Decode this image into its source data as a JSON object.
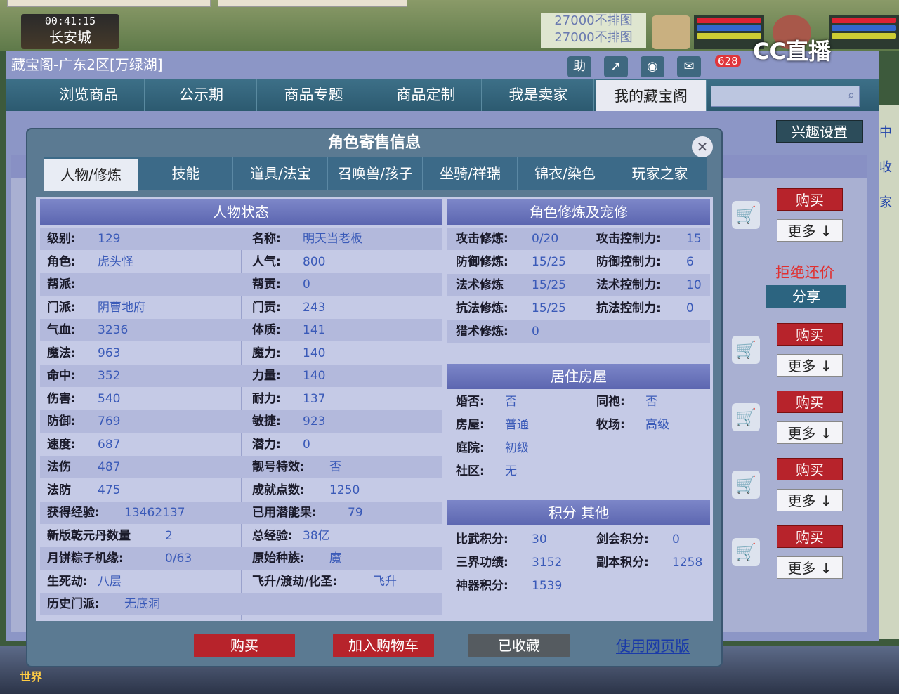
{
  "game": {
    "clock": "00:41:15",
    "city": "长安城",
    "notice_lines": [
      "27000不排图",
      "27000不排图"
    ],
    "cc_logo": "CC直播",
    "world_button": "世界"
  },
  "shop": {
    "title": "藏宝阁-广东2区[万绿湖]",
    "help_label": "助",
    "message_count": "628",
    "nav": [
      "浏览商品",
      "公示期",
      "商品专题",
      "商品定制",
      "我是卖家",
      "我的藏宝阁"
    ],
    "interest_button": "兴趣设置",
    "buy_label": "购买",
    "more_label": "更多",
    "refuse_label": "拒绝还价",
    "share_label": "分享"
  },
  "dialog": {
    "title": "角色寄售信息",
    "tabs": [
      "人物/修炼",
      "技能",
      "道具/法宝",
      "召唤兽/孩子",
      "坐骑/祥瑞",
      "锦衣/染色",
      "玩家之家"
    ],
    "status_header": "人物状态",
    "status_col1": [
      {
        "k": "级别:",
        "v": "129"
      },
      {
        "k": "角色:",
        "v": "虎头怪"
      },
      {
        "k": "帮派:",
        "v": ""
      },
      {
        "k": "门派:",
        "v": "阴曹地府"
      },
      {
        "k": "气血:",
        "v": "3236"
      },
      {
        "k": "魔法:",
        "v": "963"
      },
      {
        "k": "命中:",
        "v": "352"
      },
      {
        "k": "伤害:",
        "v": "540"
      },
      {
        "k": "防御:",
        "v": "769"
      },
      {
        "k": "速度:",
        "v": "687"
      },
      {
        "k": "法伤",
        "v": "487"
      },
      {
        "k": "法防",
        "v": "475"
      },
      {
        "k": "获得经验:",
        "v": "13462137"
      },
      {
        "k": "新版乾元丹数量",
        "v": "2"
      },
      {
        "k": "月饼粽子机缘:",
        "v": "0/63"
      },
      {
        "k": "生死劫:",
        "v": "八层"
      },
      {
        "k": "历史门派:",
        "v": "无底洞"
      }
    ],
    "status_col2": [
      {
        "k": "名称:",
        "v": "明天当老板"
      },
      {
        "k": "人气:",
        "v": "800"
      },
      {
        "k": "帮贡:",
        "v": "0"
      },
      {
        "k": "门贡:",
        "v": "243"
      },
      {
        "k": "体质:",
        "v": "141"
      },
      {
        "k": "魔力:",
        "v": "140"
      },
      {
        "k": "力量:",
        "v": "140"
      },
      {
        "k": "耐力:",
        "v": "137"
      },
      {
        "k": "敏捷:",
        "v": "923"
      },
      {
        "k": "潜力:",
        "v": "0"
      },
      {
        "k": "靓号特效:",
        "v": "否"
      },
      {
        "k": "成就点数:",
        "v": "1250"
      },
      {
        "k": "已用潜能果:",
        "v": "79"
      },
      {
        "k": "总经验:",
        "v": "38亿"
      },
      {
        "k": "原始种族:",
        "v": "魔"
      },
      {
        "k": "飞升/渡劫/化圣:",
        "v": "飞升"
      }
    ],
    "cultivation_header": "角色修炼及宠修",
    "cultivation": [
      {
        "k": "攻击修炼:",
        "v": "0/20",
        "k2": "攻击控制力:",
        "v2": "15"
      },
      {
        "k": "防御修炼:",
        "v": "15/25",
        "k2": "防御控制力:",
        "v2": "6"
      },
      {
        "k": "法术修炼",
        "v": "15/25",
        "k2": "法术控制力:",
        "v2": "10"
      },
      {
        "k": "抗法修炼:",
        "v": "15/25",
        "k2": "抗法控制力:",
        "v2": "0"
      },
      {
        "k": "猎术修炼:",
        "v": "0",
        "k2": "",
        "v2": ""
      }
    ],
    "house_header": "居住房屋",
    "house": [
      {
        "k": "婚否:",
        "v": "否",
        "k2": "同袍:",
        "v2": "否"
      },
      {
        "k": "房屋:",
        "v": "普通",
        "k2": "牧场:",
        "v2": "高级"
      },
      {
        "k": "庭院:",
        "v": "初级",
        "k2": "",
        "v2": ""
      },
      {
        "k": "社区:",
        "v": "无",
        "k2": "",
        "v2": ""
      }
    ],
    "score_header": "积分 其他",
    "score": [
      {
        "k": "比武积分:",
        "v": "30",
        "k2": "剑会积分:",
        "v2": "0"
      },
      {
        "k": "三界功绩:",
        "v": "3152",
        "k2": "副本积分:",
        "v2": "1258"
      },
      {
        "k": "神器积分:",
        "v": "1539",
        "k2": "",
        "v2": ""
      }
    ],
    "buttons": {
      "buy": "购买",
      "cart": "加入购物车",
      "fav": "已收藏",
      "web": "使用网页版"
    }
  },
  "colors": {
    "accent": "#b7232b",
    "nav": "#2c5a70",
    "value_text": "#3a5ab8"
  }
}
